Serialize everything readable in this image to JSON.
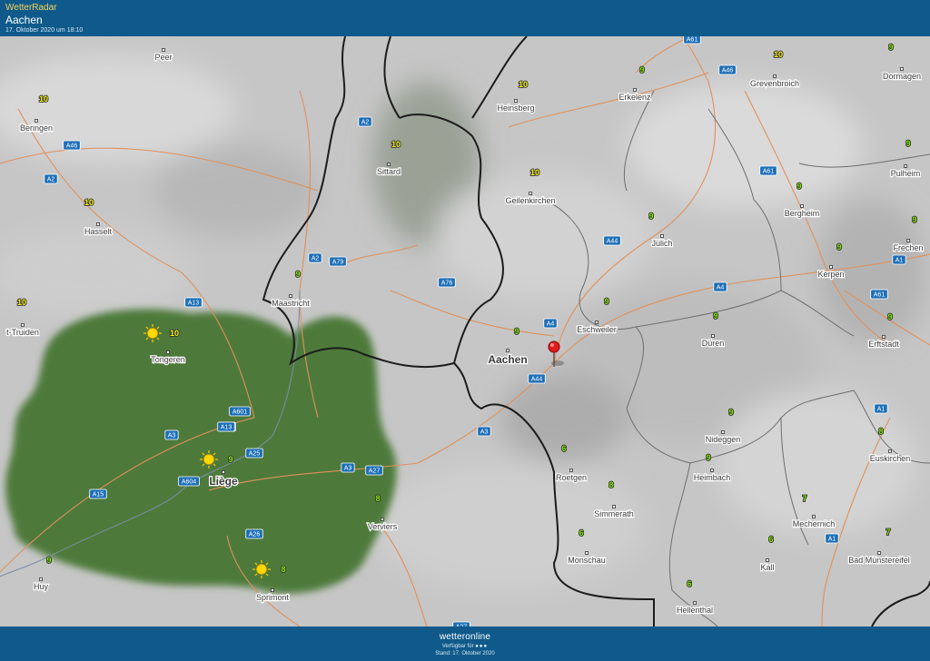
{
  "header": {
    "app_title": "WetterRadar",
    "location": "Aachen",
    "timestamp": "17. Oktober 2020 um 18:10"
  },
  "footer": {
    "brand": "wetteronline",
    "available": "Verfügbar für",
    "stand": "Stand: 17. Oktober 2020"
  },
  "colors": {
    "header_bg": "#0f5a8a",
    "header_accent": "#f6d35a",
    "radar_green": "#4e7a3a",
    "temp_yellow": "#f4f00a",
    "temp_green": "#7ee600",
    "road_shield": "#1d6fb8",
    "marker": "#e21c1c"
  },
  "map": {
    "marker_icon": "location-pin-icon",
    "cities": [
      {
        "name": "Peer",
        "temp": ""
      },
      {
        "name": "Beringen",
        "temp": "10"
      },
      {
        "name": "Hasselt",
        "temp": "10"
      },
      {
        "name": "t-Truiden",
        "temp": "10"
      },
      {
        "name": "Tongeren",
        "temp": "10",
        "sun": true
      },
      {
        "name": "Liège",
        "temp": "9",
        "sun": true
      },
      {
        "name": "Huy",
        "temp": "9"
      },
      {
        "name": "Sprimont",
        "temp": "8",
        "sun": true
      },
      {
        "name": "Verviers",
        "temp": "8"
      },
      {
        "name": "Maastricht",
        "temp": "9"
      },
      {
        "name": "Sittard",
        "temp": "10"
      },
      {
        "name": "Heinsberg",
        "temp": "10"
      },
      {
        "name": "Geilenkirchen",
        "temp": "10"
      },
      {
        "name": "Erkelenz",
        "temp": "9"
      },
      {
        "name": "Grevenbroich",
        "temp": "10"
      },
      {
        "name": "Dormagen",
        "temp": "9"
      },
      {
        "name": "Pulheim",
        "temp": "9"
      },
      {
        "name": "Bergheim",
        "temp": "9"
      },
      {
        "name": "Frechen",
        "temp": "9"
      },
      {
        "name": "Kerpen",
        "temp": "9"
      },
      {
        "name": "Jülich",
        "temp": "9"
      },
      {
        "name": "Aachen",
        "temp": "9"
      },
      {
        "name": "Eschweiler",
        "temp": "9"
      },
      {
        "name": "Düren",
        "temp": "9"
      },
      {
        "name": "Erftstadt",
        "temp": "9"
      },
      {
        "name": "Roetgen",
        "temp": "6"
      },
      {
        "name": "Nideggen",
        "temp": "9"
      },
      {
        "name": "Euskirchen",
        "temp": "8"
      },
      {
        "name": "Heimbach",
        "temp": "9"
      },
      {
        "name": "Simmerath",
        "temp": "8"
      },
      {
        "name": "Mechernich",
        "temp": "7"
      },
      {
        "name": "Monschau",
        "temp": "6"
      },
      {
        "name": "Kall",
        "temp": "6"
      },
      {
        "name": "Bad Münstereifel",
        "temp": "7"
      },
      {
        "name": "Hellenthal",
        "temp": "6"
      }
    ],
    "roads": [
      "A61",
      "A46",
      "A2",
      "A46",
      "A2",
      "A13",
      "A61",
      "A44",
      "A2",
      "A79",
      "A76",
      "A4",
      "A1",
      "A61",
      "A13",
      "A4",
      "A44",
      "A601",
      "A3",
      "A13",
      "A25",
      "A3",
      "A27",
      "A3",
      "A604",
      "A15",
      "A26",
      "A1",
      "A1",
      "A27"
    ]
  }
}
